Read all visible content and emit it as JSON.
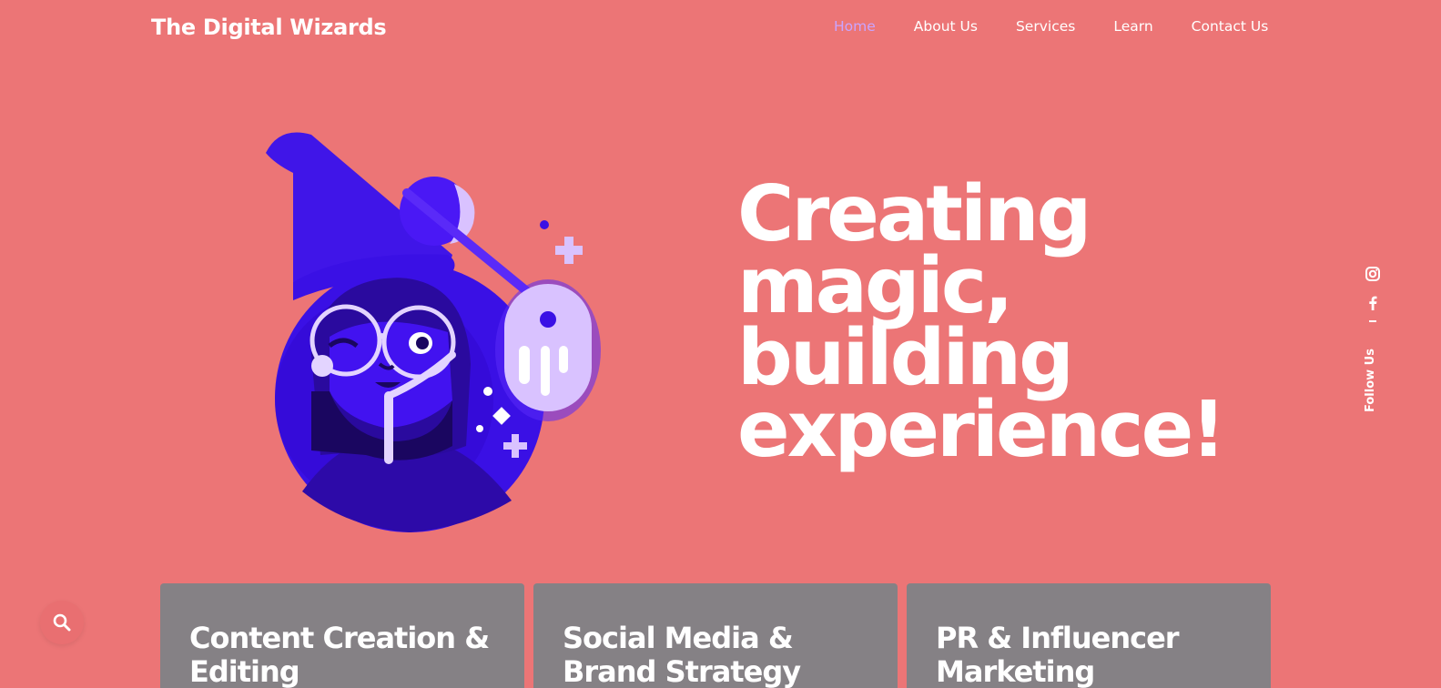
{
  "brand": {
    "name": "The Digital Wizards"
  },
  "nav": {
    "items": [
      {
        "label": "Home",
        "active": true
      },
      {
        "label": "About Us",
        "active": false
      },
      {
        "label": "Services",
        "active": false
      },
      {
        "label": "Learn",
        "active": false
      },
      {
        "label": "Contact Us",
        "active": false
      }
    ]
  },
  "hero": {
    "headline_lines": [
      "Creating",
      "magic,",
      "building",
      "experience!"
    ]
  },
  "social": {
    "label": "Follow Us",
    "icons": [
      "instagram-icon",
      "facebook-icon"
    ]
  },
  "search": {
    "icon": "search-icon"
  },
  "cards": [
    {
      "title": "Content Creation & Editing"
    },
    {
      "title": "Social Media & Brand Strategy"
    },
    {
      "title": "PR & Influencer Marketing"
    }
  ],
  "colors": {
    "background": "#ec7576",
    "nav_active": "#c9a4ff",
    "card": "#858185",
    "text": "#ffffff",
    "wizard_primary": "#3a10e5"
  }
}
